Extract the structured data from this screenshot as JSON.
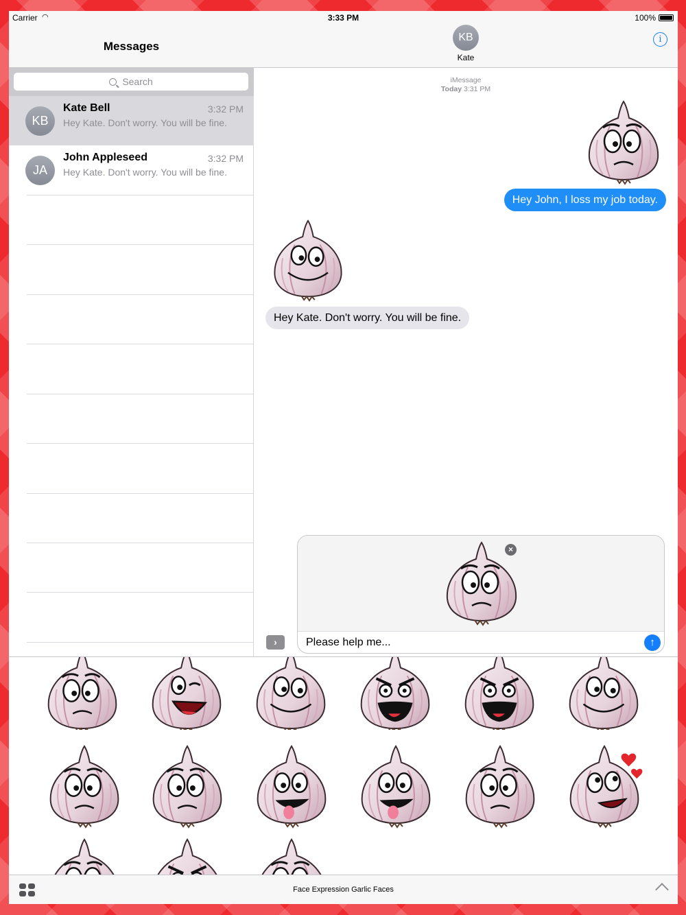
{
  "status_bar": {
    "carrier": "Carrier",
    "time": "3:33 PM",
    "battery": "100%"
  },
  "sidebar": {
    "title": "Messages",
    "search_placeholder": "Search",
    "conversations": [
      {
        "initials": "KB",
        "name": "Kate Bell",
        "time": "3:32 PM",
        "preview": "Hey Kate. Don't worry. You will be fine.",
        "selected": true
      },
      {
        "initials": "JA",
        "name": "John Appleseed",
        "time": "3:32 PM",
        "preview": "Hey Kate. Don't worry. You will be fine.",
        "selected": false
      }
    ]
  },
  "chat": {
    "contact_initials": "KB",
    "contact_name": "Kate",
    "service": "iMessage",
    "timestamp_day": "Today",
    "timestamp_time": "3:31 PM",
    "messages": [
      {
        "direction": "outgoing",
        "sticker": "garlic-worried",
        "text": "Hey John, I loss my job today."
      },
      {
        "direction": "incoming",
        "sticker": "garlic-smiling",
        "text": "Hey Kate. Don't worry. You will be fine."
      }
    ],
    "composer": {
      "attached_sticker": "garlic-frowning",
      "text": "Please help me..."
    }
  },
  "sticker_drawer": {
    "title": "Face Expression Garlic Faces",
    "stickers": [
      "garlic-nervous",
      "garlic-laughing-wink",
      "garlic-wink",
      "garlic-angry-shout",
      "garlic-shocked",
      "garlic-smiling",
      "garlic-surprised",
      "garlic-frowning",
      "garlic-silly-tongue",
      "garlic-happy-tongue",
      "garlic-sad",
      "garlic-in-love",
      "garlic-brow-raised",
      "garlic-grumpy",
      "garlic-skeptical"
    ]
  },
  "colors": {
    "accent": "#147efb",
    "outgoing_bubble": "#1f8ef7",
    "incoming_bubble": "#e6e5eb",
    "background": "#ee2a2f"
  }
}
